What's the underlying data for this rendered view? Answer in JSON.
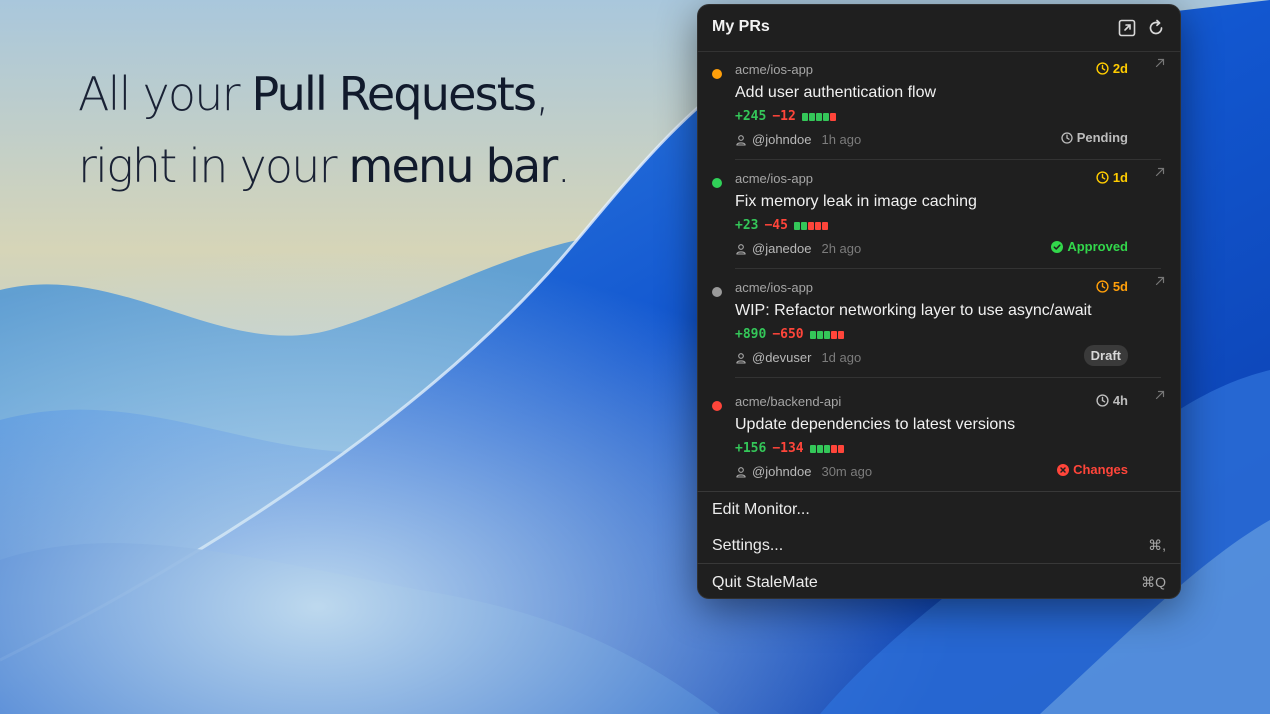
{
  "headline": {
    "line1_light": "All your ",
    "line1_strong": "Pull Requests",
    "line1_tail": ",",
    "line2_light": "right in your ",
    "line2_strong": "menu bar",
    "line2_tail": "."
  },
  "panel": {
    "title": "My PRs",
    "icons": [
      "open-external-icon",
      "refresh-icon"
    ]
  },
  "prs": [
    {
      "repo": "acme/ios-app",
      "status_color": "#ff9f0a",
      "age": "2d",
      "age_color": "#ffcc00",
      "title": "Add user authentication flow",
      "additions": "+245",
      "deletions": "−12",
      "diff_blocks": [
        "green",
        "green",
        "green",
        "green",
        "red"
      ],
      "user": "@johndoe",
      "time": "1h ago",
      "review_status": "Pending",
      "review_icon": "clock-icon",
      "review_color": "#bdbdbd"
    },
    {
      "repo": "acme/ios-app",
      "status_color": "#30d158",
      "age": "1d",
      "age_color": "#ffcc00",
      "title": "Fix memory leak in image caching",
      "additions": "+23",
      "deletions": "−45",
      "diff_blocks": [
        "green",
        "green",
        "red",
        "red",
        "red"
      ],
      "user": "@janedoe",
      "time": "2h ago",
      "review_status": "Approved",
      "review_icon": "check-circle-icon",
      "review_color": "#32d74b"
    },
    {
      "repo": "acme/ios-app",
      "status_color": "#9a9a9a",
      "age": "5d",
      "age_color": "#ff9f0a",
      "title": "WIP: Refactor networking layer to use async/await",
      "additions": "+890",
      "deletions": "−650",
      "diff_blocks": [
        "green",
        "green",
        "green",
        "red",
        "red"
      ],
      "user": "@devuser",
      "time": "1d ago",
      "review_status": "Draft",
      "review_icon": "",
      "review_color": "#d8d8d8"
    },
    {
      "repo": "acme/backend-api",
      "status_color": "#ff453a",
      "age": "4h",
      "age_color": "#bdbdbd",
      "title": "Update dependencies to latest versions",
      "additions": "+156",
      "deletions": "−134",
      "diff_blocks": [
        "green",
        "green",
        "green",
        "red",
        "red"
      ],
      "user": "@johndoe",
      "time": "30m ago",
      "review_status": "Changes",
      "review_icon": "x-circle-icon",
      "review_color": "#ff453a"
    }
  ],
  "menu": {
    "edit_monitor": "Edit Monitor...",
    "settings": "Settings...",
    "settings_shortcut": "⌘,",
    "quit": "Quit StaleMate",
    "quit_shortcut": "⌘Q"
  },
  "colors": {
    "addition": "#34c759",
    "deletion": "#ff453a",
    "panel_bg": "#1f1f1f"
  }
}
